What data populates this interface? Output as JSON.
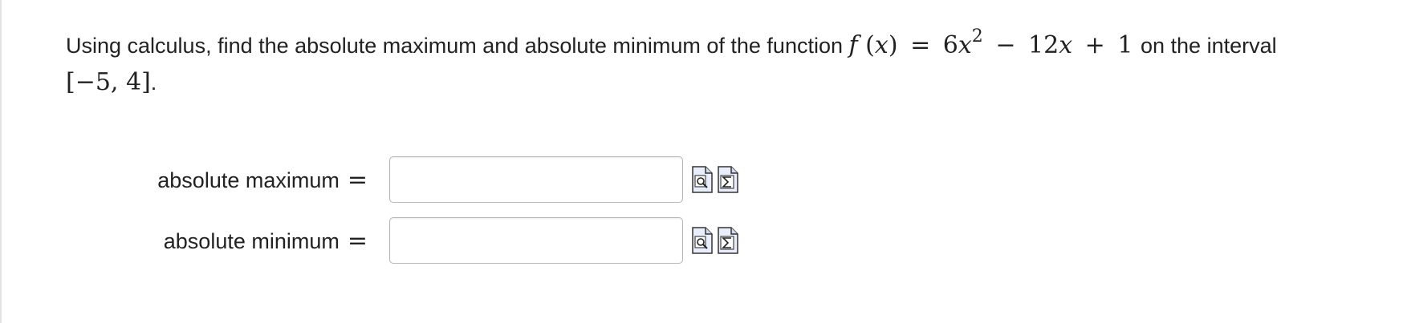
{
  "question": {
    "text_before": "Using calculus, find the absolute maximum and absolute minimum of the function",
    "function_f": "f",
    "function_open": "(",
    "function_var": "x",
    "function_close": ")",
    "equals": "=",
    "coef_a": "6",
    "var_a": "x",
    "exponent": "2",
    "minus": "−",
    "coef_b": "12",
    "var_b": "x",
    "plus": "+",
    "constant": "1",
    "text_after": "on the interval",
    "interval": "[−5, 4]",
    "period": "."
  },
  "answers": [
    {
      "label": "absolute maximum",
      "equals": "=",
      "value": "",
      "placeholder": ""
    },
    {
      "label": "absolute minimum",
      "equals": "=",
      "value": "",
      "placeholder": ""
    }
  ],
  "icons": {
    "preview": "preview-answer-icon",
    "equation_editor": "equation-editor-icon"
  }
}
